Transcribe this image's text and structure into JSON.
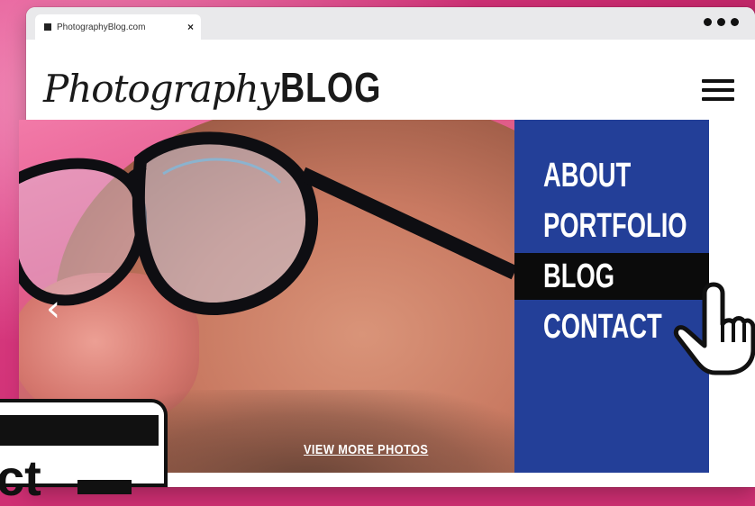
{
  "browser": {
    "tab_title": "PhotographyBlog.com",
    "tab_close": "×"
  },
  "site": {
    "logo_script": "Photography",
    "logo_block": "BLOG"
  },
  "hero": {
    "prev_arrow": "‹",
    "view_more_label": "VIEW MORE PHOTOS"
  },
  "menu": {
    "items": [
      {
        "label": "ABOUT"
      },
      {
        "label": "PORTFOLIO"
      },
      {
        "label": "BLOG",
        "active": true
      },
      {
        "label": "CONTACT"
      }
    ]
  },
  "overlay": {
    "text": "ct"
  },
  "colors": {
    "background_pink": "#d63a7d",
    "menu_blue": "#233f98",
    "menu_active": "#0b0b0b",
    "text_dark": "#1a1a1a"
  },
  "icons": [
    "menu-icon",
    "chevron-left-icon",
    "hand-pointer-icon",
    "close-icon",
    "more-dots-icon"
  ]
}
